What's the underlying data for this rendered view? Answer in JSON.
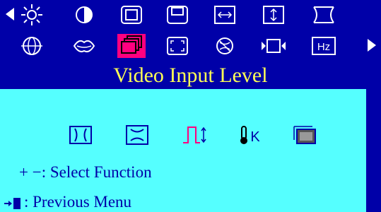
{
  "menu": {
    "title": "Video Input Level",
    "row1_icons": [
      "brightness-icon",
      "contrast-icon",
      "image-size-icon",
      "image-position-icon",
      "h-size-icon",
      "v-size-icon",
      "pincushion-icon"
    ],
    "row2_icons": [
      "geometry-icon",
      "moire-icon",
      "video-input-level-icon",
      "zoom-icon",
      "degauss-icon",
      "input-select-icon",
      "frequency-icon"
    ],
    "selected": "video-input-level-icon",
    "frequency_label": "Hz"
  },
  "submenu": {
    "icons": [
      "pincushion-icon",
      "pinbalance-icon",
      "signal-level-icon",
      "color-temperature-icon",
      "color-control-icon"
    ],
    "temp_label": "K"
  },
  "help": {
    "select_keys": "+ −",
    "select_text": ": Select Function",
    "previous_text": ": Previous Menu"
  },
  "colors": {
    "background": "#0000a8",
    "panel": "#55ffff",
    "title": "#ffff55",
    "selected": "#ff007f",
    "icon": "#ffffff"
  }
}
